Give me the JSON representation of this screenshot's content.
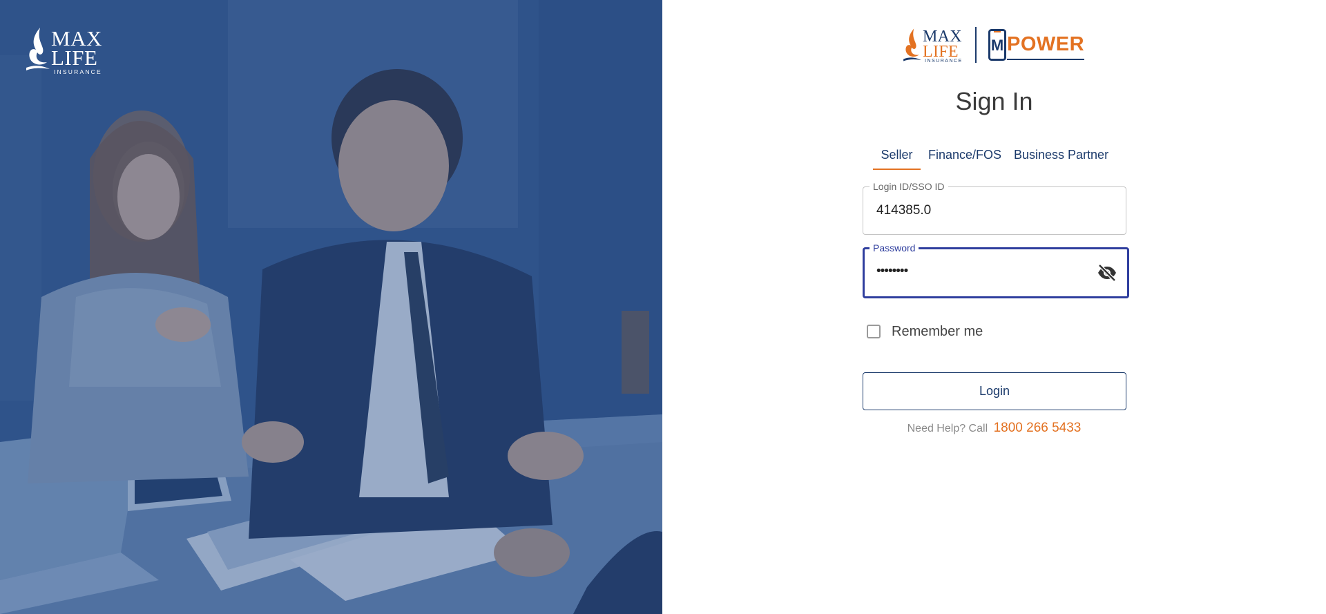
{
  "hero": {
    "logo": {
      "line1": "MAX",
      "line2": "LIFE",
      "line3": "INSURANCE"
    }
  },
  "brand": {
    "max_logo": {
      "line1": "MAX",
      "line2": "LIFE",
      "line3": "INSURANCE"
    },
    "product_phone_letter": "M",
    "product_name": "POWER"
  },
  "login": {
    "title": "Sign In",
    "tabs": [
      {
        "label": "Seller",
        "active": true
      },
      {
        "label": "Finance/FOS",
        "active": false
      },
      {
        "label": "Business Partner",
        "active": false
      }
    ],
    "login_id": {
      "label": "Login ID/SSO ID",
      "value": "414385.0"
    },
    "password": {
      "label": "Password",
      "value": "••••••••",
      "visibility_icon": "eye-off-icon"
    },
    "remember_me": {
      "label": "Remember me",
      "checked": false
    },
    "login_button": "Login",
    "help": {
      "text": "Need Help? Call",
      "phone": "1800 266 5433"
    }
  },
  "colors": {
    "brand_navy": "#1b3a6b",
    "brand_orange": "#e37222",
    "focus_blue": "#2f3e9e",
    "hero_overlay": "#2f5287"
  }
}
